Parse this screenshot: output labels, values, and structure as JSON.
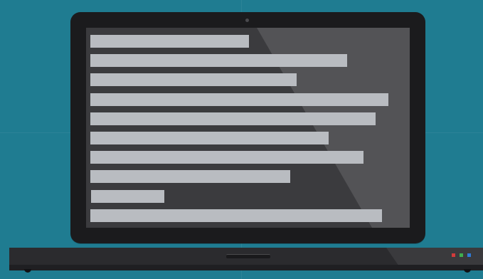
{
  "scene": {
    "background_color": "#1f7c91",
    "subject": "laptop",
    "screen_content": "placeholder-text-lines",
    "text_line_count": 10,
    "text_line_lengths": [
      0.5,
      0.81,
      0.65,
      0.94,
      0.9,
      0.75,
      0.86,
      0.63,
      0.23,
      0.92
    ]
  },
  "colors": {
    "bezel": "#1b1b1d",
    "screen": "#3b3b3e",
    "screen_glare": "#535356",
    "text_line": "#b9bcc1",
    "base": "#2b2b2e"
  },
  "indicator_lights": [
    {
      "name": "red-led",
      "color": "#d23b3b"
    },
    {
      "name": "green-led",
      "color": "#3fae4f"
    },
    {
      "name": "blue-led",
      "color": "#2f7ad8"
    }
  ]
}
